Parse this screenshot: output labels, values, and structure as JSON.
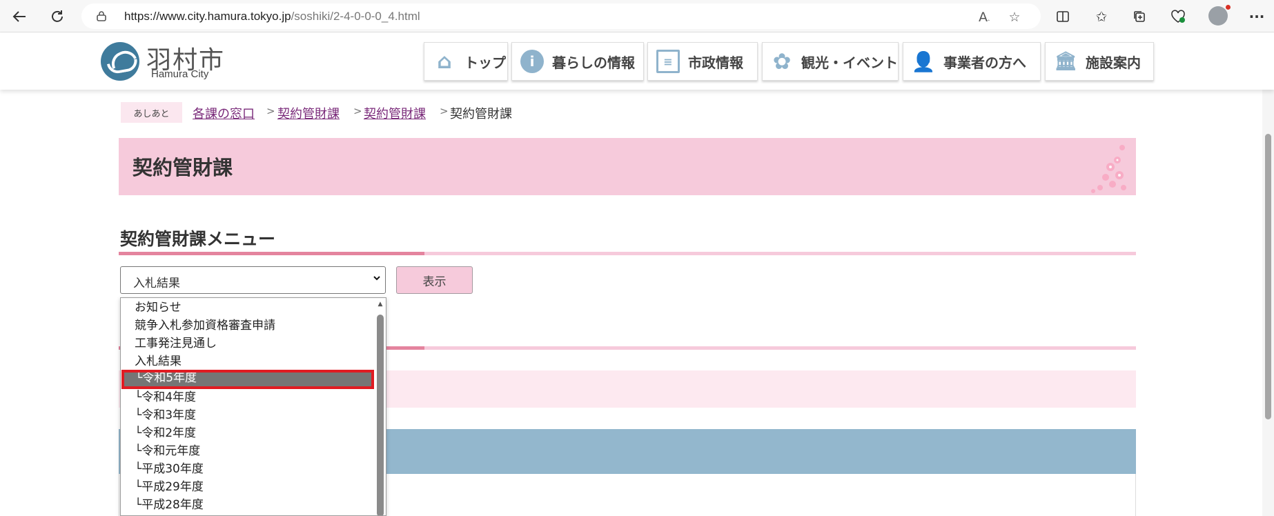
{
  "browser": {
    "url_prefix": "https://www.city.hamura.tokyo.jp",
    "url_path": "/soshiki/2-4-0-0-0_4.html"
  },
  "site": {
    "logo_jp": "羽村市",
    "logo_en": "Hamura City",
    "nav": [
      {
        "label": "トップ",
        "icon": "home-icon"
      },
      {
        "label": "暮らしの情報",
        "icon": "info-icon"
      },
      {
        "label": "市政情報",
        "icon": "newspaper-icon"
      },
      {
        "label": "観光・イベント",
        "icon": "flower-icon"
      },
      {
        "label": "事業者の方へ",
        "icon": "businessman-icon"
      },
      {
        "label": "施設案内",
        "icon": "building-icon"
      }
    ],
    "ghost_crumb": "各課の窓口"
  },
  "breadcrumb": {
    "tag": "あしあと",
    "items": [
      "各課の窓口",
      "契約管財課",
      "契約管財課"
    ],
    "current": "契約管財課"
  },
  "page": {
    "title": "契約管財課",
    "menu_title": "契約管財課メニュー",
    "select_value": "入札結果",
    "show_button": "表示"
  },
  "dropdown": {
    "options": [
      "お知らせ",
      "競争入札参加資格審査申請",
      "工事発注見通し",
      "入札結果",
      "└令和5年度",
      "└令和4年度",
      "└令和3年度",
      "└令和2年度",
      "└令和元年度",
      "└平成30年度",
      "└平成29年度",
      "└平成28年度"
    ],
    "selected_index": 4
  }
}
